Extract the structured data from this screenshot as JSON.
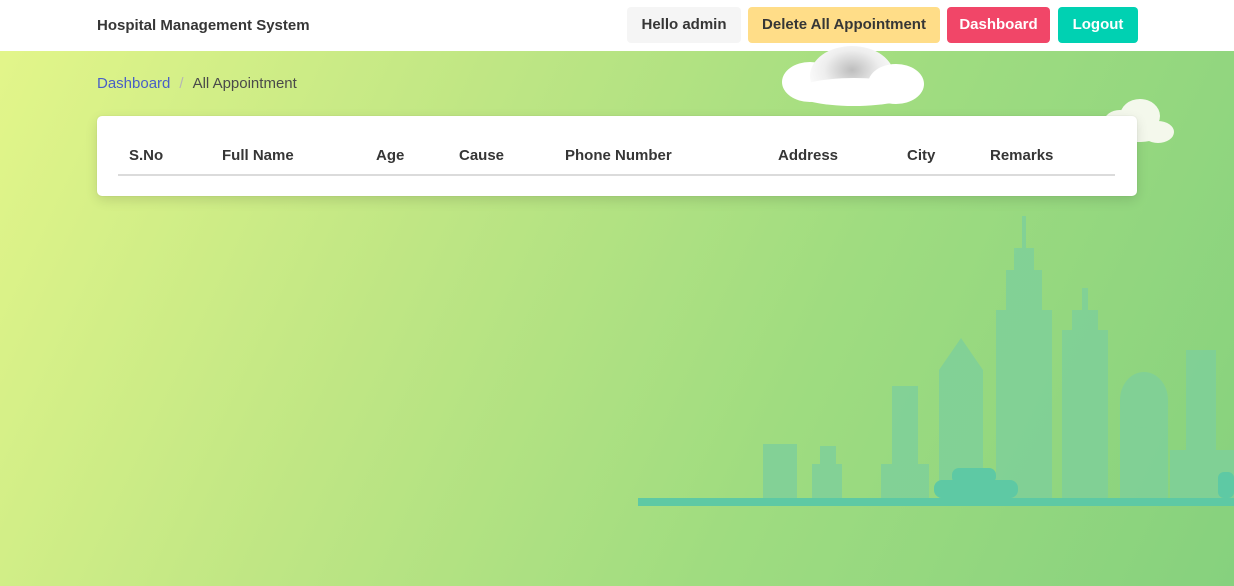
{
  "navbar": {
    "brand": "Hospital Management System",
    "greeting": "Hello admin",
    "delete_all_label": "Delete All Appointment",
    "dashboard_label": "Dashboard",
    "logout_label": "Logout"
  },
  "breadcrumb": {
    "items": [
      "Dashboard",
      "All Appointment"
    ],
    "separator": "/"
  },
  "table": {
    "columns": [
      "S.No",
      "Full Name",
      "Age",
      "Cause",
      "Phone Number",
      "Address",
      "City",
      "Remarks"
    ],
    "rows": []
  },
  "colors": {
    "dashboard_button": "#f14668",
    "logout_button": "#00d1b2",
    "delete_button": "#ffdd88",
    "skyline": "#5ec9a4"
  }
}
